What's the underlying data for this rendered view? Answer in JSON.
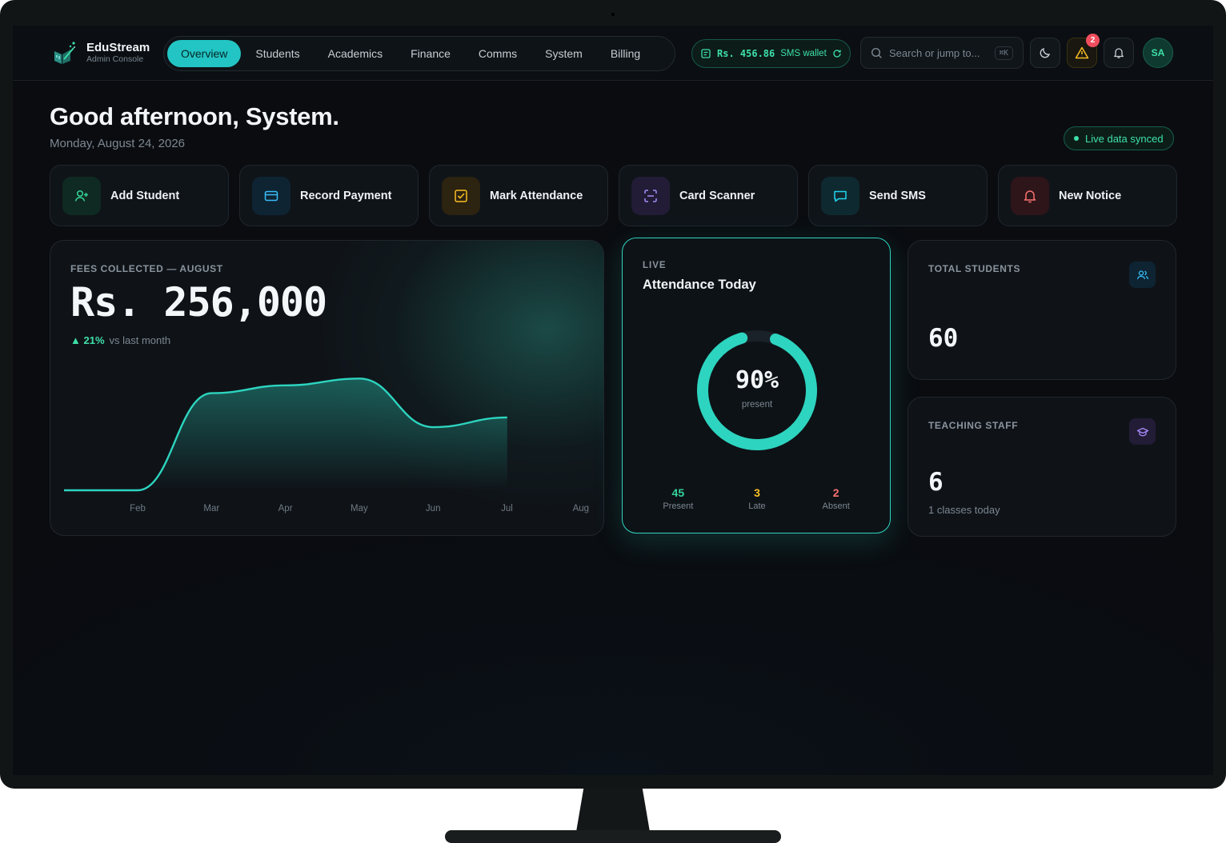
{
  "brand": {
    "name": "EduStream",
    "subtitle": "Admin Console"
  },
  "nav": {
    "items": [
      {
        "label": "Overview",
        "active": true
      },
      {
        "label": "Students",
        "active": false
      },
      {
        "label": "Academics",
        "active": false
      },
      {
        "label": "Finance",
        "active": false
      },
      {
        "label": "Comms",
        "active": false
      },
      {
        "label": "System",
        "active": false
      },
      {
        "label": "Billing",
        "active": false
      }
    ]
  },
  "wallet": {
    "amount": "Rs. 456.86",
    "label": "SMS wallet"
  },
  "search": {
    "placeholder": "Search or jump to...",
    "shortcut": "⌘K"
  },
  "alerts": {
    "warning_count": "2"
  },
  "user": {
    "initials": "SA"
  },
  "greeting": {
    "title": "Good afternoon, System.",
    "date": "Monday, August 24, 2026"
  },
  "sync": {
    "label": "Live data synced"
  },
  "actions": [
    {
      "label": "Add Student",
      "icon": "user-plus-icon",
      "color": "#34d399",
      "bg": "#0f2a22"
    },
    {
      "label": "Record Payment",
      "icon": "credit-card-icon",
      "color": "#38bdf8",
      "bg": "#0e2433"
    },
    {
      "label": "Mark Attendance",
      "icon": "checkbox-icon",
      "color": "#fbbf24",
      "bg": "#2c2310"
    },
    {
      "label": "Card Scanner",
      "icon": "scan-icon",
      "color": "#a78bfa",
      "bg": "#221c36"
    },
    {
      "label": "Send SMS",
      "icon": "message-icon",
      "color": "#22d3ee",
      "bg": "#0e2a30"
    },
    {
      "label": "New Notice",
      "icon": "bell-icon",
      "color": "#f87171",
      "bg": "#2e1519"
    }
  ],
  "fees": {
    "label": "FEES COLLECTED — AUGUST",
    "amount": "Rs. 256,000",
    "trend_value": "▲ 21%",
    "trend_text": "vs last month"
  },
  "chart_data": {
    "type": "area",
    "categories": [
      "Feb",
      "Mar",
      "Apr",
      "May",
      "Jun",
      "Jul",
      "Aug"
    ],
    "values": [
      0,
      0,
      100000,
      108000,
      115000,
      65000,
      75000
    ],
    "title": "",
    "xlabel": "",
    "ylabel": "",
    "ylim": [
      0,
      140000
    ],
    "grid": false,
    "color": "#2dd4bf"
  },
  "attendance": {
    "live": "LIVE",
    "title": "Attendance Today",
    "percent_label": "90%",
    "percent_value": 0.9,
    "percent_sub": "present",
    "stats": [
      {
        "value": "45",
        "label": "Present",
        "color": "#34d399"
      },
      {
        "value": "3",
        "label": "Late",
        "color": "#fbbf24"
      },
      {
        "value": "2",
        "label": "Absent",
        "color": "#f87171"
      }
    ]
  },
  "students": {
    "label": "TOTAL STUDENTS",
    "value": "60"
  },
  "staff": {
    "label": "TEACHING STAFF",
    "value": "6",
    "sub": "1 classes today"
  }
}
